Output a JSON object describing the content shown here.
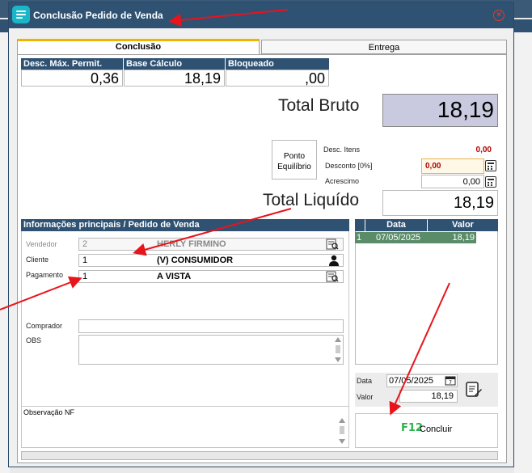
{
  "window": {
    "title": "Conclusão Pedido de Venda"
  },
  "tabs": [
    {
      "label": "Conclusão"
    },
    {
      "label": "Entrega"
    }
  ],
  "summary": {
    "headers": [
      "Desc. Máx. Permit.",
      "Base Cálculo",
      "Bloqueado"
    ],
    "values": [
      "0,36",
      "18,19",
      ",00"
    ]
  },
  "totals": {
    "bruto_label": "Total Bruto",
    "bruto_value": "18,19",
    "liquido_label": "Total Liquído",
    "liquido_value": "18,19"
  },
  "ponto_equilibrio": {
    "label": "Ponto Equilíbrio"
  },
  "discounts": {
    "desc_itens_label": "Desc. Itens",
    "desc_itens_value": "0,00",
    "desconto_label": "Desconto [0%]",
    "desconto_value": "0,00",
    "acrescimo_label": "Acrescimo",
    "acrescimo_value": "0,00"
  },
  "info": {
    "header": "Informações principais / Pedido de Venda",
    "vendedor_label": "Vendedor",
    "vendedor_code": "2",
    "vendedor_name": "HERLY FIRMINO",
    "cliente_label": "Cliente",
    "cliente_code": "1",
    "cliente_name": "(V) CONSUMIDOR",
    "pagamento_label": "Pagamento",
    "pagamento_code": "1",
    "pagamento_name": "A VISTA",
    "comprador_label": "Comprador",
    "obs_label": "OBS",
    "observacao_nf_label": "Observação NF"
  },
  "installments": {
    "headers": [
      "Data",
      "Valor"
    ],
    "rows": [
      {
        "num": "1",
        "data": "07/05/2025",
        "valor": "18,19"
      }
    ]
  },
  "payment_entry": {
    "data_label": "Data",
    "data_value": "07/05/2025",
    "valor_label": "Valor",
    "valor_value": "18,19"
  },
  "concluir": {
    "key": "F12",
    "label": "Concluir"
  },
  "colors": {
    "header_bg": "#2f5273",
    "selected_row": "#5a8c6a",
    "annotation_arrow": "#e8141b"
  }
}
